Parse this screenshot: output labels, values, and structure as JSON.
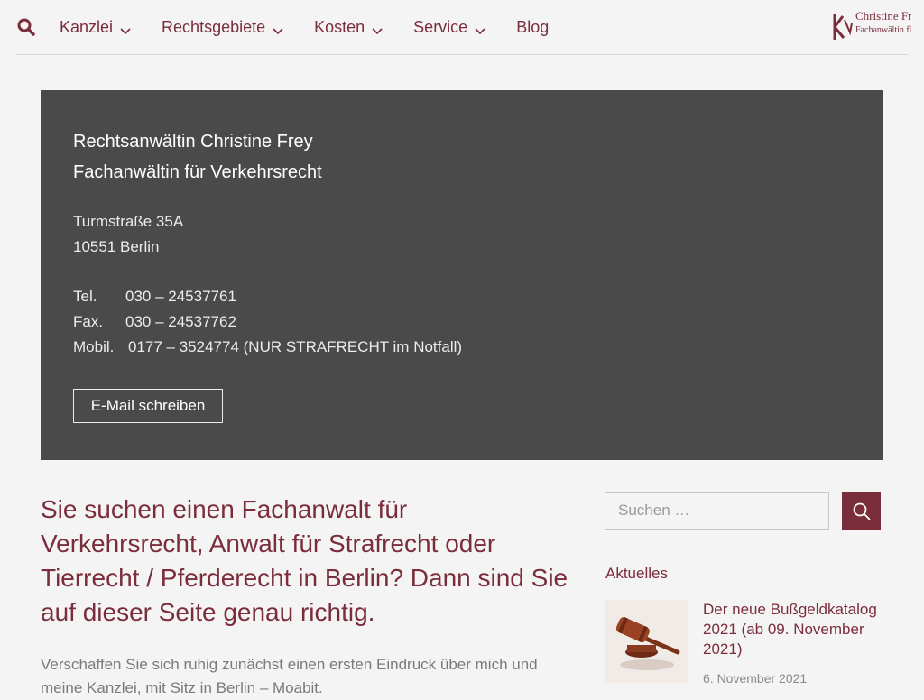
{
  "header": {
    "search_icon": "search-icon",
    "nav": [
      {
        "label": "Kanzlei",
        "has_dropdown": true
      },
      {
        "label": "Rechtsgebiete",
        "has_dropdown": true
      },
      {
        "label": "Kosten",
        "has_dropdown": true
      },
      {
        "label": "Service",
        "has_dropdown": true
      },
      {
        "label": "Blog",
        "has_dropdown": false
      }
    ],
    "logo": {
      "line1": "Christine Frey",
      "line2": "Fachanwältin für"
    }
  },
  "hero": {
    "name_line1": "Rechtsanwältin Christine Frey",
    "name_line2": "Fachanwältin für Verkehrsrecht",
    "street": "Turmstraße 35A",
    "city": "10551 Berlin",
    "tel_label": "Tel.",
    "tel_value": "030 – 24537761",
    "fax_label": "Fax.",
    "fax_value": "030 – 24537762",
    "mobil_label": "Mobil.",
    "mobil_value": "0177 – 3524774 (NUR STRAFRECHT im Notfall)",
    "email_button": "E-Mail schreiben"
  },
  "main": {
    "heading": "Sie suchen einen Fachanwalt für Verkehrsrecht, Anwalt für Strafrecht oder Tierrecht / Pferderecht in Berlin? Dann sind Sie auf dieser Seite genau richtig.",
    "intro": "Verschaffen Sie sich ruhig zunächst einen ersten Eindruck über mich und meine Kanzlei, mit Sitz in Berlin – Moabit."
  },
  "sidebar": {
    "search_placeholder": "Suchen …",
    "section_title": "Aktuelles",
    "post_title": "Der neue Bußgeldkatalog 2021 (ab 09. November 2021)",
    "post_date": "6. November 2021"
  },
  "colors": {
    "accent": "#7a2d3b",
    "hero_bg": "#4a4a4a",
    "page_bg": "#f5f4f4"
  }
}
